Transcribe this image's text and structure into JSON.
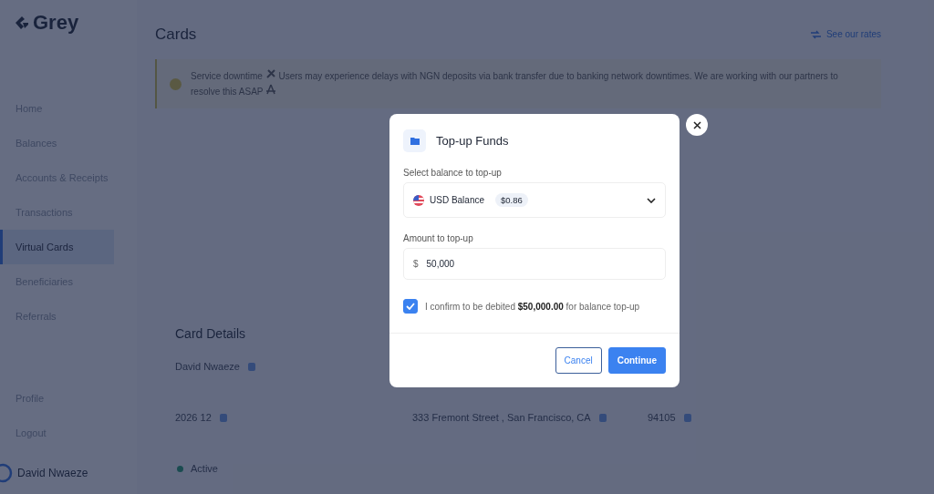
{
  "sidebar": {
    "logo": "Grey",
    "items": [
      {
        "label": "Home",
        "selected": false
      },
      {
        "label": "Balances",
        "selected": false
      },
      {
        "label": "Accounts & Receipts",
        "selected": false
      },
      {
        "label": "Transactions",
        "selected": false
      },
      {
        "label": "Virtual Cards",
        "selected": true
      },
      {
        "label": "Beneficiaries",
        "selected": false
      },
      {
        "label": "Referrals",
        "selected": false
      }
    ],
    "bottom_items": [
      {
        "label": "Profile"
      },
      {
        "label": "Logout"
      }
    ],
    "user": "David Nwaeze"
  },
  "page": {
    "title": "Cards",
    "rates_link": "See our rates",
    "banner": {
      "text": "Service downtime",
      "message": "Users may experience delays with NGN deposits via bank transfer due to banking network downtimes. We are working with our partners to resolve this ASAP"
    },
    "card_details": {
      "title": "Card Details",
      "rows": [
        [
          {
            "kind": "copyable",
            "value": "David Nwaeze"
          }
        ],
        [
          {
            "kind": "copyable",
            "value": "2026 12"
          },
          {
            "kind": "copyable",
            "value": "333 Fremont Street , San Francisco, CA"
          },
          {
            "kind": "copyable",
            "value": "94105"
          }
        ],
        [
          {
            "kind": "status",
            "value": "Active"
          }
        ]
      ]
    }
  },
  "modal": {
    "title": "Top-up Funds",
    "balance": {
      "label": "Select balance to top-up",
      "value": "USD Balance",
      "badge": "$0.86"
    },
    "amount": {
      "label": "Amount to top-up",
      "currency": "$",
      "value": "50,000"
    },
    "confirm": {
      "checked": true,
      "text": "I confirm to be debited **$50,000.00** for balance top-up"
    },
    "buttons": [
      {
        "label": "Cancel",
        "kind": "secondary"
      },
      {
        "label": "Continue",
        "kind": "primary"
      }
    ]
  }
}
